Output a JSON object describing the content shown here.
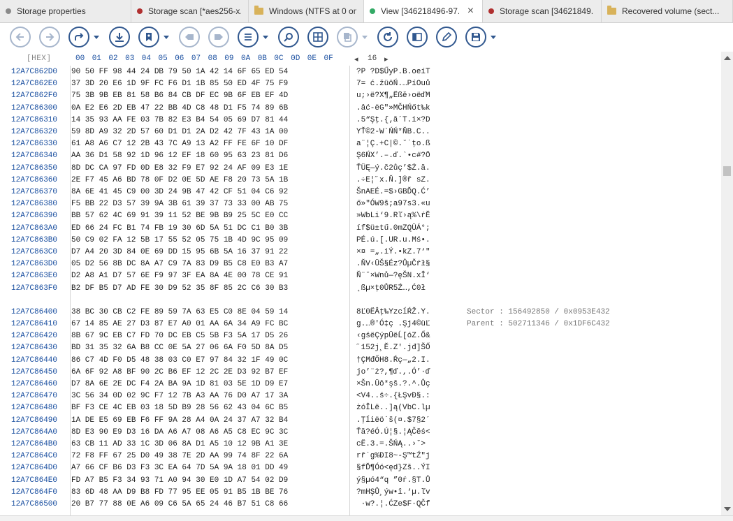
{
  "tabs": [
    {
      "label": "Storage properties",
      "color": "#8a8a8a",
      "kind": "dot",
      "width": 188
    },
    {
      "label": "Storage scan [*aes256-x...",
      "color": "#b03030",
      "kind": "dot",
      "width": 168
    },
    {
      "label": "Windows  (NTFS at 0 on...",
      "color": "#d8b25a",
      "kind": "folder",
      "width": 165
    },
    {
      "label": "View [346218496-97...",
      "color": "#33aa66",
      "kind": "dot",
      "width": 170,
      "active": true,
      "close": "×"
    },
    {
      "label": "Storage scan [34621849...",
      "color": "#b03030",
      "kind": "dot",
      "width": 170
    },
    {
      "label": "Recovered volume (sect...",
      "color": "#d8b25a",
      "kind": "folder",
      "width": 188
    }
  ],
  "toolbar": [
    {
      "name": "back-button",
      "icon": "arrow-left-icon",
      "disabled": true
    },
    {
      "name": "forward-button",
      "icon": "arrow-right-icon",
      "disabled": true
    },
    {
      "name": "goto-button",
      "icon": "redirect-icon",
      "dropdown": true
    },
    {
      "name": "save-data-button",
      "icon": "download-icon"
    },
    {
      "name": "bookmark-button",
      "icon": "bookmark-icon",
      "dropdown": true
    },
    {
      "name": "prev-bookmark-button",
      "icon": "prev-bookmark-icon",
      "disabled": true
    },
    {
      "name": "next-bookmark-button",
      "icon": "next-bookmark-icon",
      "disabled": true
    },
    {
      "name": "list-button",
      "icon": "list-icon",
      "dropdown": true
    },
    {
      "name": "search-button",
      "icon": "search-icon"
    },
    {
      "name": "grid-button",
      "icon": "grid-icon"
    },
    {
      "name": "copy-button",
      "icon": "copy-icon",
      "disabled": true,
      "dropdown": true
    },
    {
      "name": "refresh-button",
      "icon": "refresh-icon"
    },
    {
      "name": "panel-button",
      "icon": "panel-icon"
    },
    {
      "name": "edit-button",
      "icon": "pencil-icon"
    },
    {
      "name": "save-button",
      "icon": "floppy-icon",
      "dropdown": true
    }
  ],
  "hex": {
    "hex_label": "[HEX]",
    "columns": [
      "00",
      "01",
      "02",
      "03",
      "04",
      "05",
      "06",
      "07",
      "08",
      "09",
      "0A",
      "0B",
      "0C",
      "0D",
      "0E",
      "0F"
    ],
    "page_prev": "◂",
    "page_size": "16",
    "page_next": "▸",
    "blocks": [
      {
        "rows": [
          [
            "12A7C862D0",
            "90 50 FF 98 44 24 DB 79 50 1A 42 14 6F 65 ED 54",
            "?P ?D$ŰyP.B.oeíT"
          ],
          [
            "12A7C862E0",
            "37 3D 20 E6 1D 9F FC F6 D1 1B 85 50 ED 4F 75 F9",
            "7= ć.žüöŃ.…PíOuů"
          ],
          [
            "12A7C862F0",
            "75 3B 9B EB 81 58 B6 84 CB DF EC 9B 6F EB EF 4D",
            "u;›ë?X¶„Ëßě›oëďM"
          ],
          [
            "12A7C86300",
            "0A E2 E6 2D EB 47 22 BB 4D C8 48 D1 F5 74 89 6B",
            ".âć-ëG\"»MČHŃőt‰k"
          ],
          [
            "12A7C86310",
            "14 35 93 AA FE 03 7B 82 E3 B4 54 05 69 D7 81 44",
            ".5“Şţ.{‚ă´T.i×?D"
          ],
          [
            "12A7C86320",
            "59 8D A9 32 2D 57 60 D1 D1 2A D2 42 7F 43 1A 00",
            "YŤ©2-W`ŃŃ*ŇB.C.."
          ],
          [
            "12A7C86330",
            "61 A8 A6 C7 12 2B 43 7C A9 13 A2 FF FE 6F 10 DF",
            "a¨¦Ç.+C|©.˘˙ţo.ß"
          ],
          [
            "12A7C86340",
            "AA 36 D1 58 92 1D 96 12 EF 18 60 95 63 23 81 D6",
            "Ş6ŃX’.–.ď.`•c#?Ö"
          ],
          [
            "12A7C86350",
            "8D DC CA 97 FD 0D E8 32 F9 E7 92 24 AF 09 E3 1E",
            "ŤÜĘ—ý.č2ůç’$Ż.ă."
          ],
          [
            "12A7C86360",
            "2E F7 45 A6 BD 78 0F D2 0E 5D AE F8 20 73 5A 1B",
            ".÷E¦˝x.Ň.]®ř sZ."
          ],
          [
            "12A7C86370",
            "8A 6E 41 45 C9 00 3D 24 9B 47 42 CF 51 04 C6 92",
            "ŠnAEÉ.=$›GBĎQ.Ć’"
          ],
          [
            "12A7C86380",
            "F5 BB 22 D3 57 39 9A 3B 61 39 37 73 33 00 AB 75",
            "ő»\"ÓW9š;a97s3.«u"
          ],
          [
            "12A7C86390",
            "BB 57 62 4C 69 91 39 11 52 BE 9B B9 25 5C E0 CC",
            "»WbLi‘9.Rľ›ą%\\ŕĚ"
          ],
          [
            "12A7C863A0",
            "ED 66 24 FC B1 74 FB 19 30 6D 5A 51 DC C1 B0 3B",
            "íf$ü±tű.0mZQÜÁ°;"
          ],
          [
            "12A7C863B0",
            "50 C9 02 FA 12 5B 17 55 52 05 75 1B 4D 9C 95 09",
            "PÉ.ú.[.UR.u.Mś•."
          ],
          [
            "12A7C863C0",
            "D7 A4 20 3D 84 0E 69 DD 15 95 6B 5A 16 37 91 22",
            "×¤ =„.iÝ.•kZ.7‘\""
          ],
          [
            "12A7C863D0",
            "05 D2 56 8B DC 8A A7 C9 7A 83 D9 B5 C8 E0 B3 A7",
            ".ŇV‹ÜŠ§Éz?ŮµČŕł§"
          ],
          [
            "12A7C863E0",
            "D2 A8 A1 D7 57 6E F9 97 3F EA 8A 4E 00 78 CE 91",
            "Ň¨ˇ×Wnů—?ęŠN.xÎ‘"
          ],
          [
            "12A7C863F0",
            "B2 DF B5 D7 AD FE 30 D9 52 35 8F 85 2C C6 30 B3",
            "˛ßµ×­ţ0ŮR5Ź…,Ć0ł"
          ]
        ]
      },
      {
        "rows": [
          [
            "12A7C86400",
            "38 BC 30 CB C2 FE 89 59 7A 63 E5 C0 8E 04 59 14",
            "8Ľ0ËÂţ‰YzcĺŔŽ.Y."
          ],
          [
            "12A7C86410",
            "67 14 85 AE 27 D3 87 E7 A0 01 AA 6A 34 A9 FC BC",
            "g.…®'Ó‡ç .Şj4©üĽ"
          ],
          [
            "12A7C86420",
            "8B 67 9C EB C7 FD 70 DC EB C5 5B F3 5A 17 D5 26",
            "‹gśëÇýpÜëĹ[óZ.Ő&"
          ],
          [
            "12A7C86430",
            "BD 31 35 32 6A B8 CC 0E 5A 27 06 6A F0 5D 8A D5",
            "˝152j¸Ě.Z'.jđ]ŠŐ"
          ],
          [
            "12A7C86440",
            "86 C7 4D F0 D5 48 38 03 C0 E7 97 84 32 1F 49 0C",
            "†ÇMđŐH8.Ŕç—„2.I."
          ],
          [
            "12A7C86450",
            "6A 6F 92 A8 BF 90 2C B6 EF 12 2C 2E D3 92 B7 EF",
            "jo’¨ż?,¶ď.,.Ó’·ď"
          ],
          [
            "12A7C86460",
            "D7 8A 6E 2E DC F4 2A BA 9A 1D 81 03 5E 1D D9 E7",
            "×Šn.Üô*şš.?.^.Ůç"
          ],
          [
            "12A7C86470",
            "3C 56 34 0D 02 9C F7 12 7B A3 AA 76 D0 A7 17 3A",
            "<V4..ś÷.{ŁŞvĐ§.:"
          ],
          [
            "12A7C86480",
            "BF F3 CE 4C EB 03 18 5D B9 28 56 62 43 04 6C B5",
            "żóÎLë..]ą(VbC.lµ"
          ],
          [
            "12A7C86490",
            "1A DE E5 69 EB F6 FF 9A 28 A4 0A 24 37 A7 32 B4",
            ".Ţĺiëö˙š(¤.$7§2´"
          ],
          [
            "12A7C864A0",
            "8D E3 90 E9 D3 16 DA A6 A7 08 A6 A5 C8 EC 9C 3C",
            "Ťă?éÓ.Ú¦§.¦ĄČěś<"
          ],
          [
            "12A7C864B0",
            "63 CB 11 AD 33 1C 3D 06 8A D1 A5 10 12 9B A1 3E",
            "cË.­3.=.ŠŃĄ..›ˇ>"
          ],
          [
            "12A7C864C0",
            "72 F8 FF 67 25 D0 49 38 7E 2D AA 99 74 8F 22 6A",
            "rř˙g%ĐI8~-Ş™tŹ\"j"
          ],
          [
            "12A7C864D0",
            "A7 66 CF B6 D3 F3 3C EA 64 7D 5A 9A 18 01 DD 49",
            "§fĎ¶Óó<ęd}Zš..ÝI"
          ],
          [
            "12A7C864E0",
            "FD A7 B5 F3 34 93 71 A0 94 30 E0 1D A7 54 02 D9",
            "ý§µó4“q ”0ŕ.§T.Ů"
          ],
          [
            "12A7C864F0",
            "83 6D 48 AA D9 B8 FD 77 95 EE 05 91 B5 1B BE 76",
            "?mHŞŮ¸ýw•î.‘µ.ľv"
          ],
          [
            "12A7C86500",
            "20 B7 77 88 0E A6 09 C6 5A 65 24 46 B7 51 C8 66",
            " ·w?.¦.ĆZe$F·QČf"
          ]
        ]
      }
    ],
    "info": [
      {
        "label": "Sector",
        "sep": " : ",
        "value": "156492850 / 0x0953E432"
      },
      {
        "label": "Parent",
        "sep": " : ",
        "value": "502711346 / 0x1DF6C432"
      }
    ]
  }
}
